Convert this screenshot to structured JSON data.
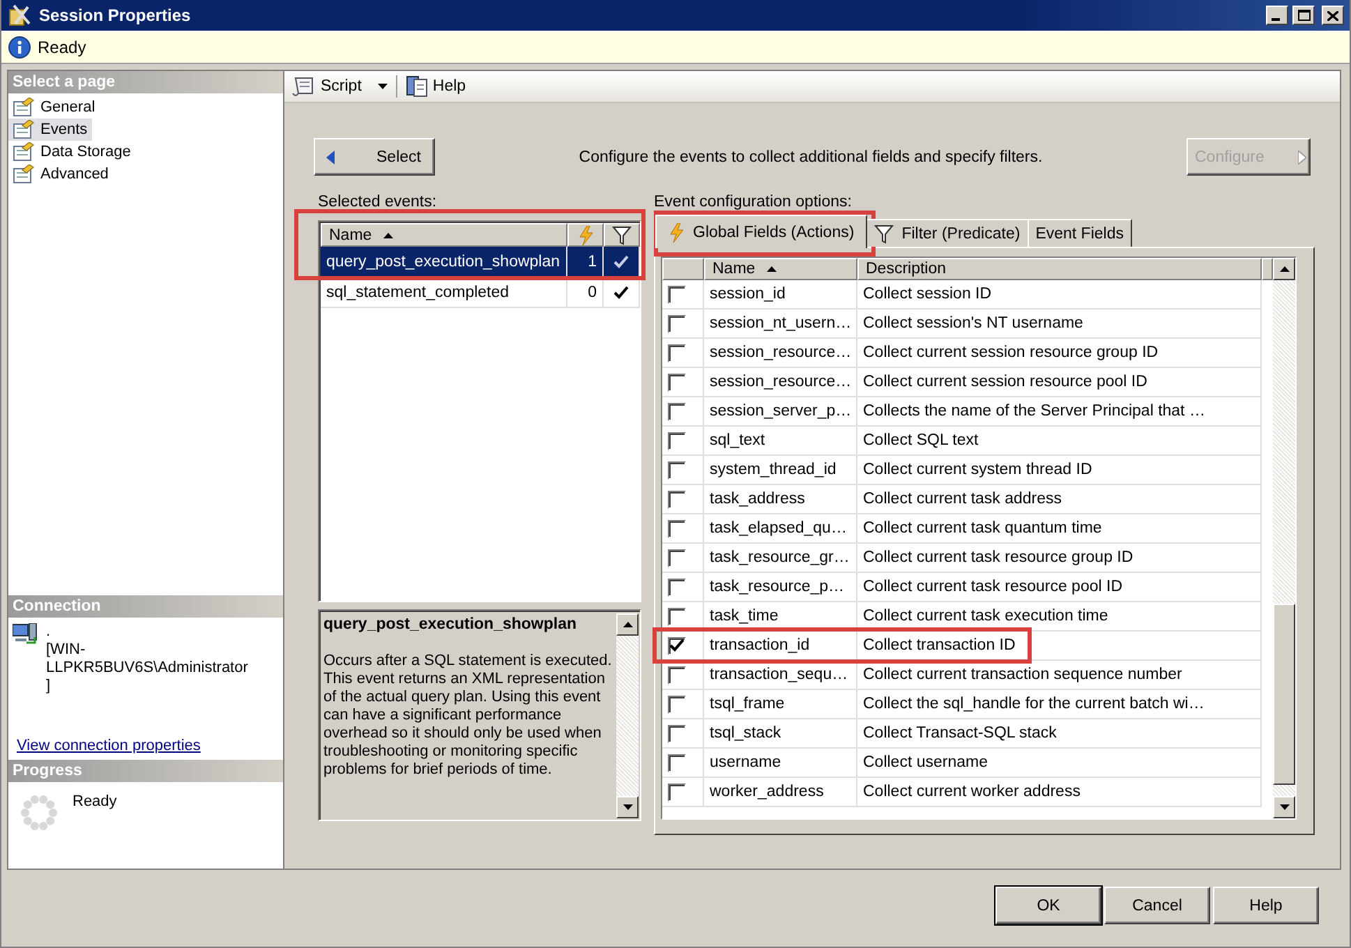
{
  "window": {
    "title": "Session Properties"
  },
  "status": {
    "text": "Ready"
  },
  "pages": {
    "header": "Select a page",
    "items": [
      {
        "label": "General",
        "selected": false
      },
      {
        "label": "Events",
        "selected": true
      },
      {
        "label": "Data Storage",
        "selected": false
      },
      {
        "label": "Advanced",
        "selected": false
      }
    ]
  },
  "connection": {
    "header": "Connection",
    "lines": [
      ".",
      "[WIN-LLPKR5BUV6S\\Administrator",
      "]"
    ],
    "link": "View connection properties"
  },
  "progress": {
    "header": "Progress",
    "status": "Ready"
  },
  "toolbar": {
    "items": [
      {
        "label": "Script",
        "kind": "dropdown"
      },
      {
        "label": "Help",
        "kind": "help"
      }
    ]
  },
  "select_button": {
    "label": "Select"
  },
  "instruction": "Configure the events to collect additional fields and specify filters.",
  "configure_button": {
    "label": "Configure",
    "disabled": true
  },
  "selected_events": {
    "label": "Selected events:",
    "columns": [
      {
        "label": "Name",
        "sorted": true
      }
    ],
    "rows": [
      {
        "name": "query_post_execution_showplan",
        "actions": "1",
        "filtered": true,
        "selected": true,
        "highlighted": true
      },
      {
        "name": "sql_statement_completed",
        "actions": "0",
        "filtered": true,
        "selected": false,
        "highlighted": false
      }
    ]
  },
  "description": {
    "title": "query_post_execution_showplan",
    "text": "Occurs after a SQL statement is executed. This event returns an XML representation of the actual query plan. Using this event can have a significant performance overhead so it should only be used when troubleshooting or monitoring specific problems for brief periods of time."
  },
  "config": {
    "label": "Event configuration options:",
    "tabs": [
      {
        "label": "Global Fields (Actions)",
        "kind": "actions",
        "selected": true,
        "highlighted": true
      },
      {
        "label": "Filter (Predicate)",
        "kind": "predicate",
        "selected": false,
        "highlighted": false
      },
      {
        "label": "Event Fields",
        "kind": "fields",
        "selected": false,
        "highlighted": false
      }
    ],
    "columns": [
      {
        "label": "Name",
        "sorted": true
      },
      {
        "label": "Description",
        "sorted": false
      }
    ],
    "rows": [
      {
        "name": "session_id",
        "description": "Collect session ID",
        "checked": false,
        "highlighted": false
      },
      {
        "name": "session_nt_usern…",
        "description": "Collect session's NT username",
        "checked": false,
        "highlighted": false
      },
      {
        "name": "session_resource…",
        "description": "Collect current session resource group ID",
        "checked": false,
        "highlighted": false
      },
      {
        "name": "session_resource…",
        "description": "Collect current session resource pool ID",
        "checked": false,
        "highlighted": false
      },
      {
        "name": "session_server_p…",
        "description": "Collects the name of the Server Principal that …",
        "checked": false,
        "highlighted": false
      },
      {
        "name": "sql_text",
        "description": "Collect SQL text",
        "checked": false,
        "highlighted": false
      },
      {
        "name": "system_thread_id",
        "description": "Collect current system thread ID",
        "checked": false,
        "highlighted": false
      },
      {
        "name": "task_address",
        "description": "Collect current task address",
        "checked": false,
        "highlighted": false
      },
      {
        "name": "task_elapsed_qu…",
        "description": "Collect current task quantum time",
        "checked": false,
        "highlighted": false
      },
      {
        "name": "task_resource_gr…",
        "description": "Collect current task resource group ID",
        "checked": false,
        "highlighted": false
      },
      {
        "name": "task_resource_p…",
        "description": "Collect current task resource pool ID",
        "checked": false,
        "highlighted": false
      },
      {
        "name": "task_time",
        "description": "Collect current task execution time",
        "checked": false,
        "highlighted": false
      },
      {
        "name": "transaction_id",
        "description": "Collect transaction ID",
        "checked": true,
        "highlighted": true
      },
      {
        "name": "transaction_sequ…",
        "description": "Collect current transaction sequence number",
        "checked": false,
        "highlighted": false
      },
      {
        "name": "tsql_frame",
        "description": "Collect the sql_handle for the current batch wi…",
        "checked": false,
        "highlighted": false
      },
      {
        "name": "tsql_stack",
        "description": "Collect Transact-SQL stack",
        "checked": false,
        "highlighted": false
      },
      {
        "name": "username",
        "description": "Collect username",
        "checked": false,
        "highlighted": false
      },
      {
        "name": "worker_address",
        "description": "Collect current worker address",
        "checked": false,
        "highlighted": false
      }
    ]
  },
  "buttons": [
    {
      "label": "OK",
      "default": true
    },
    {
      "label": "Cancel",
      "default": false
    },
    {
      "label": "Help",
      "default": false
    }
  ]
}
